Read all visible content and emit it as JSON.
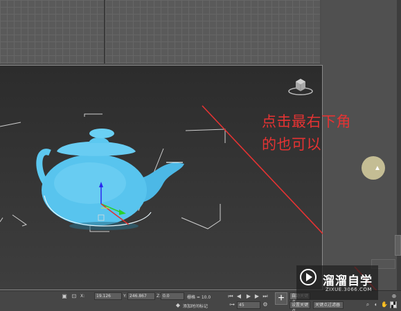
{
  "annotation": {
    "line1": "点击最右下角",
    "line2": "的也可以"
  },
  "statusbar": {
    "x_label": "X:",
    "x_value": "19.126",
    "y_label": "Y:",
    "y_value": "246.867",
    "z_label": "Z:",
    "z_value": "0.0",
    "grid_text": "栅格 = 10.0",
    "add_time_tag": "添加时间标记",
    "frame_value": "45",
    "auto_key": "自动关键点",
    "selected": "选定对象",
    "set_key": "设置关键点",
    "key_filters": "关键点过滤器"
  },
  "watermark": {
    "title": "溜溜自学",
    "url": "ZIXUE.3066.COM"
  },
  "colors": {
    "teapot": "#5cc8f0",
    "annotation": "#e53333",
    "arrow": "#e53333"
  },
  "icons": {
    "viewcube": "viewcube-icon",
    "lock": "lock-icon",
    "play": "play-icon",
    "maximize_viewport": "maximize-viewport-icon"
  }
}
